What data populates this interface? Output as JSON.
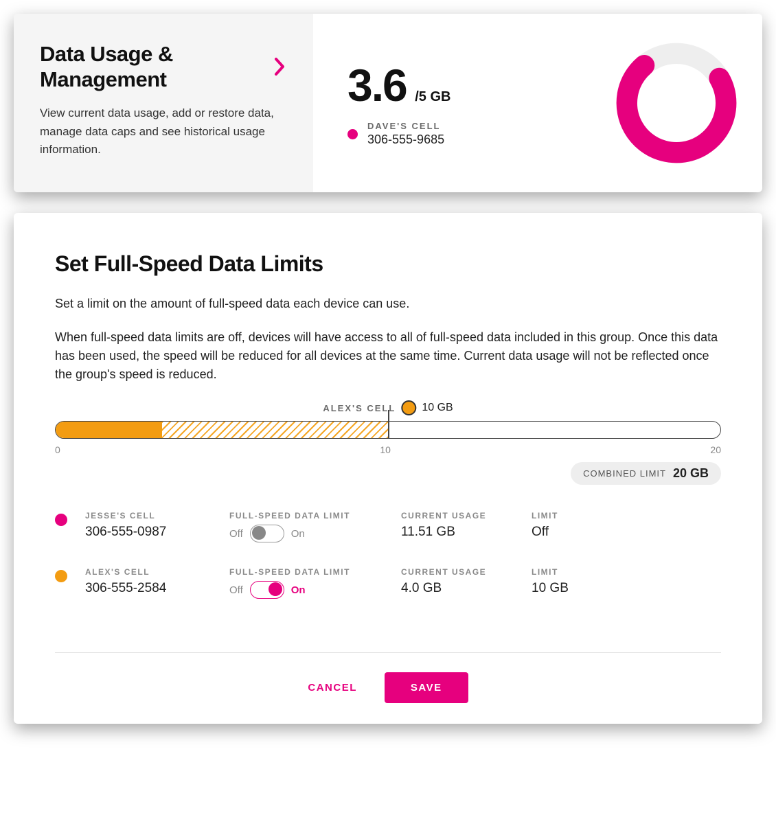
{
  "colors": {
    "magenta": "#e6007e",
    "orange": "#f39c12",
    "grey": "#888"
  },
  "top": {
    "title": "Data Usage & Management",
    "description": "View current data usage, add or restore data, manage data caps and see historical usage information.",
    "used": "3.6",
    "total": "/5 GB",
    "device_name": "DAVE'S CELL",
    "device_phone": "306-555-9685",
    "donut_percent": 72
  },
  "limits": {
    "title": "Set Full-Speed Data Limits",
    "lead": "Set a limit on the amount of full-speed data each device can use.",
    "body": "When full-speed data limits are off, devices will have access to all of full-speed data included in this group. Once this data has been used, the speed will be reduced for all devices at the same time. Current data usage will not be reflected once the group's speed is reduced.",
    "marker_name": "ALEX'S CELL",
    "marker_value": "10 GB",
    "scale_min": "0",
    "scale_mid": "10",
    "scale_max": "20",
    "combined_label": "COMBINED LIMIT",
    "combined_value": "20 GB",
    "toggle_label": "FULL-SPEED DATA LIMIT",
    "off_text": "Off",
    "on_text": "On",
    "usage_label": "CURRENT USAGE",
    "limit_label": "LIMIT",
    "devices": [
      {
        "name": "JESSE'S CELL",
        "phone": "306-555-0987",
        "usage": "11.51 GB",
        "limit": "Off",
        "toggle_on": false,
        "dot_color": "#e6007e"
      },
      {
        "name": "ALEX'S CELL",
        "phone": "306-555-2584",
        "usage": "4.0 GB",
        "limit": "10 GB",
        "toggle_on": true,
        "dot_color": "#f39c12"
      }
    ]
  },
  "footer": {
    "cancel": "CANCEL",
    "save": "SAVE"
  }
}
